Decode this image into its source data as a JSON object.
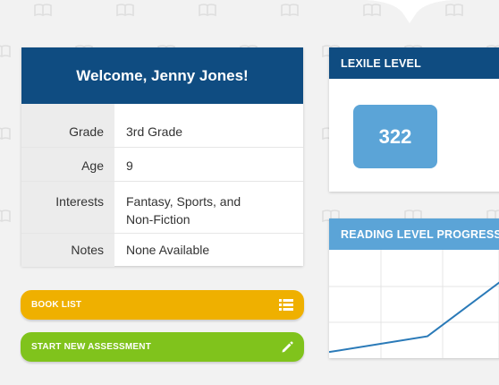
{
  "profile": {
    "welcome": "Welcome, Jenny Jones!",
    "rows": [
      {
        "label": "Grade",
        "value": "3rd Grade"
      },
      {
        "label": "Age",
        "value": "9"
      },
      {
        "label": "Interests",
        "value_line1": "Fantasy, Sports, and",
        "value_line2": "Non-Fiction"
      },
      {
        "label": "Notes",
        "value": "None Available"
      }
    ]
  },
  "actions": {
    "book_list": "BOOK LIST",
    "start_assessment": "START NEW ASSESSMENT"
  },
  "lexile": {
    "title": "LEXILE LEVEL",
    "value": "322"
  },
  "progress": {
    "title": "READING LEVEL PROGRESS"
  },
  "icons": {
    "background": "book-icon",
    "book_list": "list-icon",
    "assessment": "pencil-icon"
  },
  "colors": {
    "navy": "#0f4c81",
    "light_blue": "#5ba4d7",
    "yellow": "#efb000",
    "green": "#80c31c"
  },
  "chart_data": {
    "type": "line",
    "title": "",
    "series": [
      {
        "values": [
          0.2,
          0.8,
          3.1
        ]
      }
    ],
    "x": [
      0,
      1,
      2
    ],
    "ylim": [
      0,
      4
    ],
    "grid": true
  }
}
